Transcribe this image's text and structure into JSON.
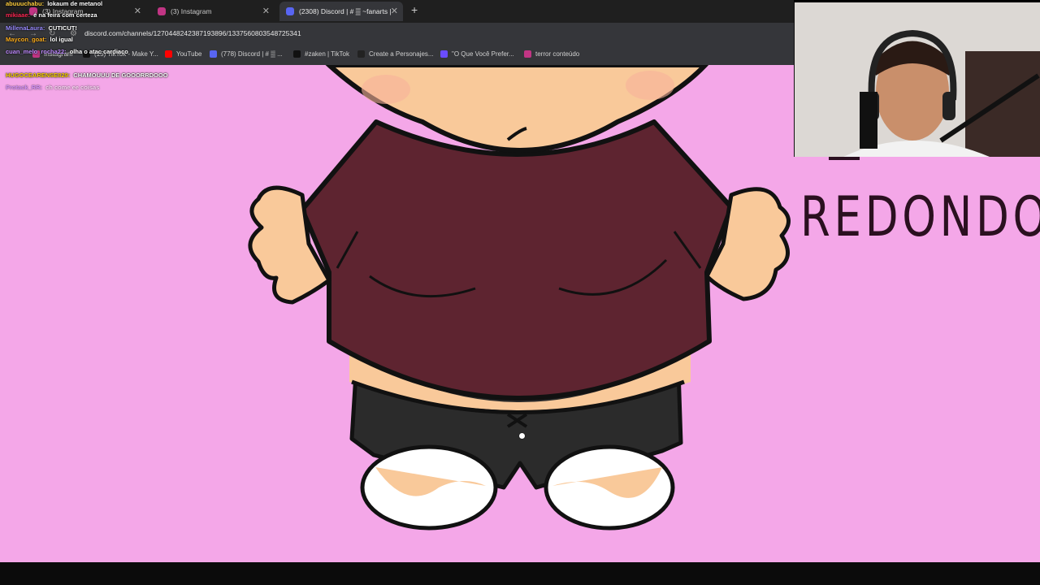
{
  "browser": {
    "tabs": [
      {
        "label": "(3) Instagram",
        "favicon": "instagram-icon",
        "favicon_color": "#c13584",
        "active": false
      },
      {
        "label": "(3) Instagram",
        "favicon": "instagram-icon",
        "favicon_color": "#c13584",
        "active": false
      },
      {
        "label": "(2308) Discord | # ▒ ~fanarts | ",
        "favicon": "discord-icon",
        "favicon_color": "#5865f2",
        "active": true
      }
    ],
    "new_tab": "+",
    "url": "discord.com/channels/1270448242387193896/1337560803548725341",
    "bookmarks": [
      {
        "label": "Instagram",
        "icon": "instagram-icon",
        "color": "#c13584"
      },
      {
        "label": "(15) TikTok - Make Y...",
        "icon": "tiktok-icon",
        "color": "#111111"
      },
      {
        "label": "YouTube",
        "icon": "youtube-icon",
        "color": "#ff0000"
      },
      {
        "label": "(778) Discord | # ▒ ...",
        "icon": "discord-icon",
        "color": "#5865f2"
      },
      {
        "label": "#zaken | TikTok",
        "icon": "tiktok-icon",
        "color": "#111111"
      },
      {
        "label": "Create a Personajes...",
        "icon": "page-icon",
        "color": "#222222"
      },
      {
        "label": "\"O Que Você Prefer...",
        "icon": "page-icon",
        "color": "#6a4cff"
      },
      {
        "label": "terror conteúdo",
        "icon": "instagram-icon",
        "color": "#c13584"
      }
    ]
  },
  "chat": [
    {
      "user": "abuuuchabu:",
      "user_color": "#ffcf3f",
      "message": "lokaum de metanol"
    },
    {
      "user": "mikiaae:",
      "user_color": "#ff2a55",
      "message": "é na feira com certeza"
    },
    {
      "user": "MillenaLaura:",
      "user_color": "#9b8cff",
      "message": "CUTICUT!"
    },
    {
      "user": "Maycon_goat:",
      "user_color": "#ffb020",
      "message": "lol igual"
    },
    {
      "user": "cuan_melo_rocha22:",
      "user_color": "#c08cff",
      "message": "olha o atac cardiaco"
    },
    {
      "user": "HUGOCEARENSE829:",
      "user_color": "#ffd700",
      "message": "CHAMOUUU DE GOOORRDOOO"
    },
    {
      "user": "Protack_RR:",
      "user_color": "#b07cff",
      "message": "ch come ee coisas"
    }
  ],
  "canvas": {
    "background": "#f4a7e8",
    "sketch_text": "REDONDO"
  },
  "colors": {
    "skin": "#f9c99a",
    "shirt": "#5e2430",
    "shorts": "#2b2b2b",
    "outline": "#111111"
  }
}
